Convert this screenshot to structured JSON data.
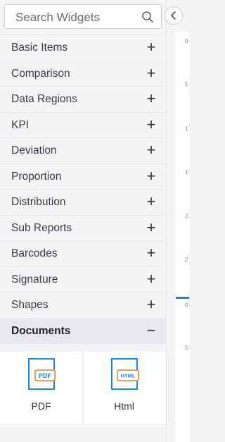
{
  "search": {
    "placeholder": "Search Widgets"
  },
  "categories": [
    {
      "label": "Basic Items",
      "toggle": "+"
    },
    {
      "label": "Comparison",
      "toggle": "+"
    },
    {
      "label": "Data Regions",
      "toggle": "+"
    },
    {
      "label": "KPI",
      "toggle": "+"
    },
    {
      "label": "Deviation",
      "toggle": "+"
    },
    {
      "label": "Proportion",
      "toggle": "+"
    },
    {
      "label": "Distribution",
      "toggle": "+"
    },
    {
      "label": "Sub Reports",
      "toggle": "+"
    },
    {
      "label": "Barcodes",
      "toggle": "+"
    },
    {
      "label": "Signature",
      "toggle": "+"
    },
    {
      "label": "Shapes",
      "toggle": "+"
    },
    {
      "label": "Documents",
      "toggle": "−"
    }
  ],
  "documents": [
    {
      "caption": "PDF",
      "badge": "PDF"
    },
    {
      "caption": "Html",
      "badge": "HTML"
    }
  ],
  "ruler_ticks": [
    "0",
    "5",
    "1",
    "1",
    "2",
    "2",
    "0",
    "5"
  ],
  "colors": {
    "accent": "#1f87e5",
    "badge": "#f07c28"
  }
}
